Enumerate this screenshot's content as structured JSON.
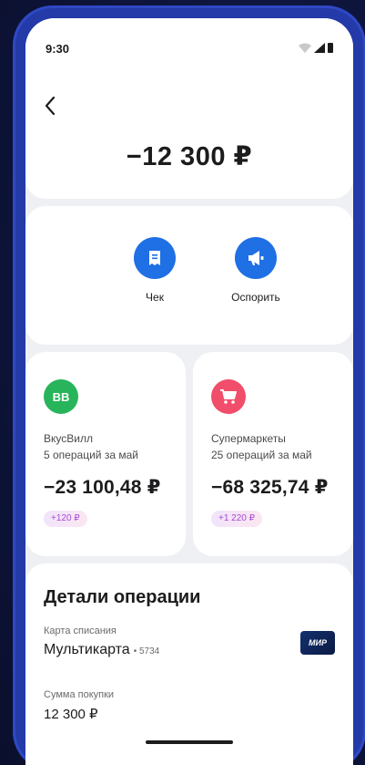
{
  "status": {
    "time": "9:30"
  },
  "operation": {
    "amount": "−12 300 ₽"
  },
  "actions": [
    {
      "label": "Чек",
      "icon": "receipt-icon"
    },
    {
      "label": "Оспорить",
      "icon": "megaphone-icon"
    }
  ],
  "merchants": [
    {
      "logo_text": "ВВ",
      "logo_color": "#27b45a",
      "name": "ВкусВилл",
      "ops": "5 операций за май",
      "sum": "−23 100,48 ₽",
      "bonus": "+120 ₽"
    },
    {
      "logo_text": "",
      "logo_color": "#f04e6a",
      "name": "Супермаркеты",
      "ops": "25 операций за май",
      "sum": "−68 325,74 ₽",
      "bonus": "+1 220 ₽"
    }
  ],
  "details": {
    "title": "Детали операции",
    "card_label": "Карта списания",
    "card_name": "Мультикарта",
    "card_suffix": "• 5734",
    "payment_system": "МИР",
    "sum_label": "Сумма покупки",
    "sum_value": "12 300 ₽"
  },
  "colors": {
    "accent": "#1f6fe5",
    "phone_frame": "#243aa8"
  }
}
